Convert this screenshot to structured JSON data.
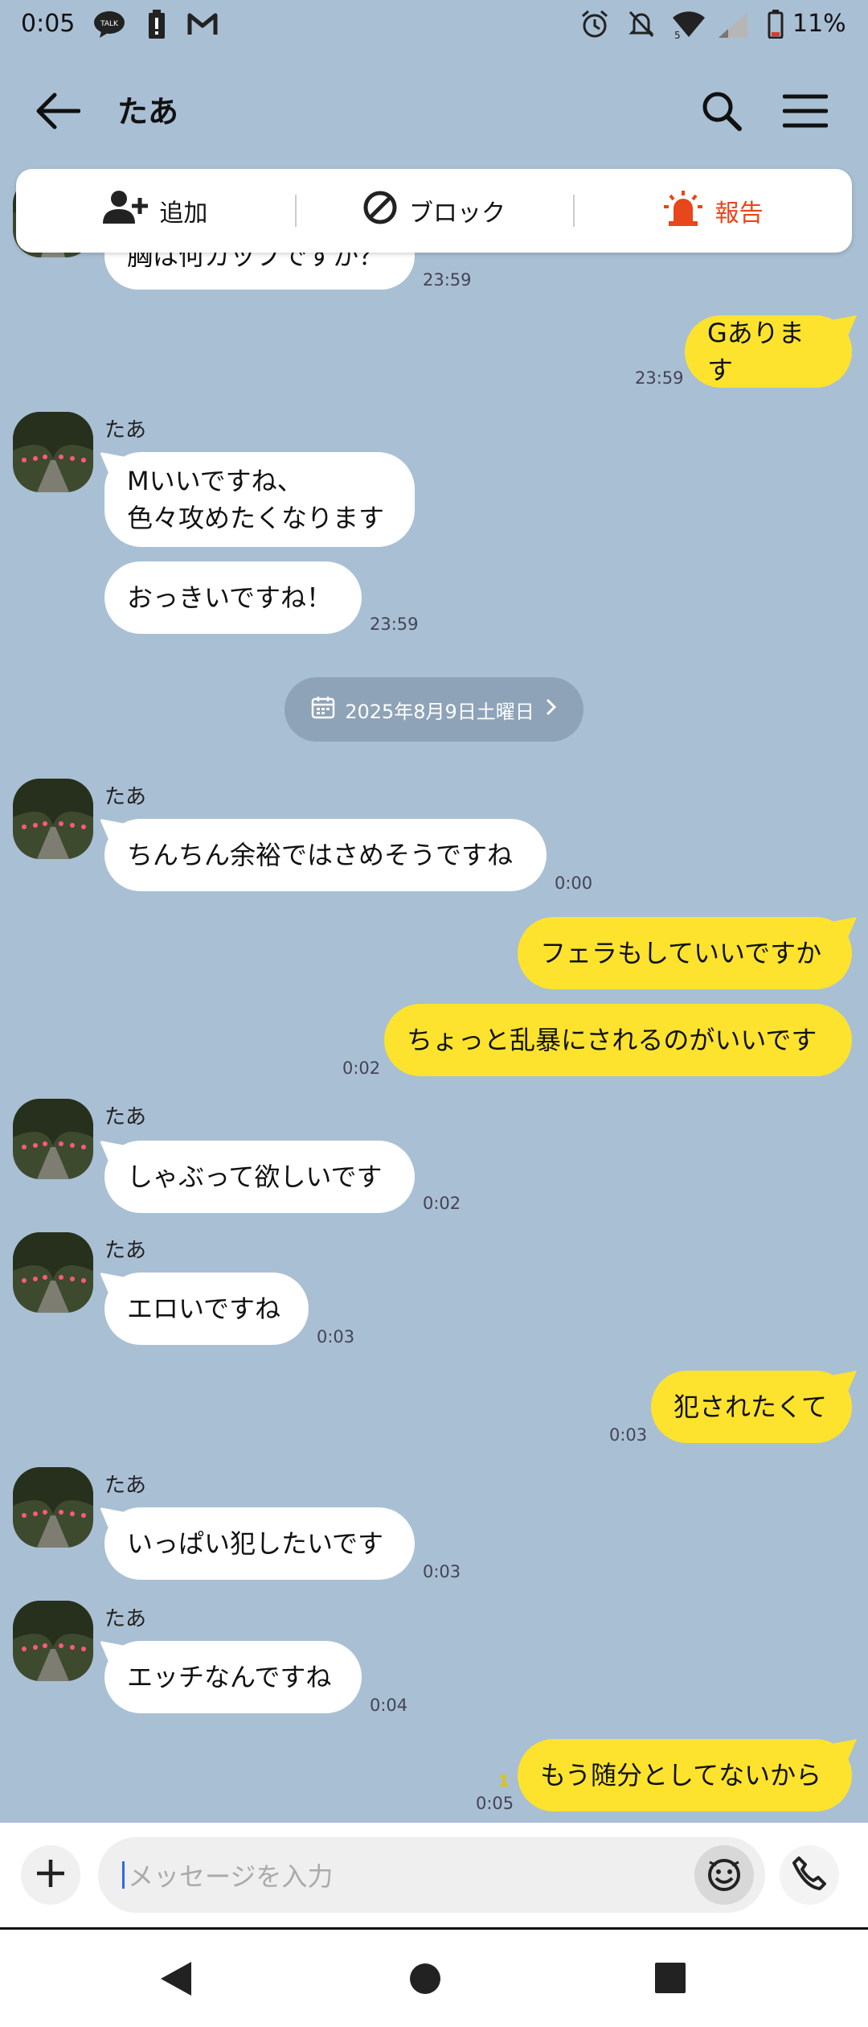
{
  "status_bar": {
    "time": "0:05",
    "battery": "11%",
    "icons": [
      "talk-icon",
      "battery-alert-icon",
      "gmail-icon",
      "alarm-icon",
      "silent-icon",
      "wifi-icon",
      "signal-icon",
      "battery-icon"
    ]
  },
  "header": {
    "title": "たあ",
    "back_icon": "back-arrow-icon",
    "search_icon": "search-icon",
    "menu_icon": "menu-icon"
  },
  "action_bar": {
    "add_label": "追加",
    "block_label": "ブロック",
    "report_label": "報告",
    "report_color": "#e8461b"
  },
  "messages": {
    "m1": {
      "text": "胸は何カップですか？",
      "time": "23:59"
    },
    "m2": {
      "text": "Gあります",
      "time": "23:59"
    },
    "m3": {
      "sender": "たあ",
      "line1": "Mいいですね、",
      "line2": "色々攻めたくなります"
    },
    "m4": {
      "text": "おっきいですね！",
      "time": "23:59"
    },
    "date_separator": "2025年8月9日土曜日",
    "m5": {
      "sender": "たあ",
      "text": "ちんちん余裕ではさめそうですね",
      "time": "0:00"
    },
    "m6": {
      "text": "フェラもしていいですか"
    },
    "m7": {
      "text": "ちょっと乱暴にされるのがいいです",
      "time": "0:02"
    },
    "m8": {
      "sender": "たあ",
      "text": "しゃぶって欲しいです",
      "time": "0:02"
    },
    "m9": {
      "sender": "たあ",
      "text": "エロいですね",
      "time": "0:03"
    },
    "m10": {
      "text": "犯されたくて",
      "time": "0:03"
    },
    "m11": {
      "sender": "たあ",
      "text": "いっぱい犯したいです",
      "time": "0:03"
    },
    "m12": {
      "sender": "たあ",
      "text": "エッチなんですね",
      "time": "0:04"
    },
    "m13": {
      "text": "もう随分としてないから",
      "time": "0:05",
      "unread": "1"
    }
  },
  "input": {
    "placeholder": "メッセージを入力",
    "plus_icon": "plus-icon",
    "emoji_icon": "emoji-icon",
    "call_icon": "phone-icon"
  },
  "colors": {
    "chat_background": "#a9bfd4",
    "outgoing_bubble": "#fde32e",
    "incoming_bubble": "#ffffff"
  }
}
